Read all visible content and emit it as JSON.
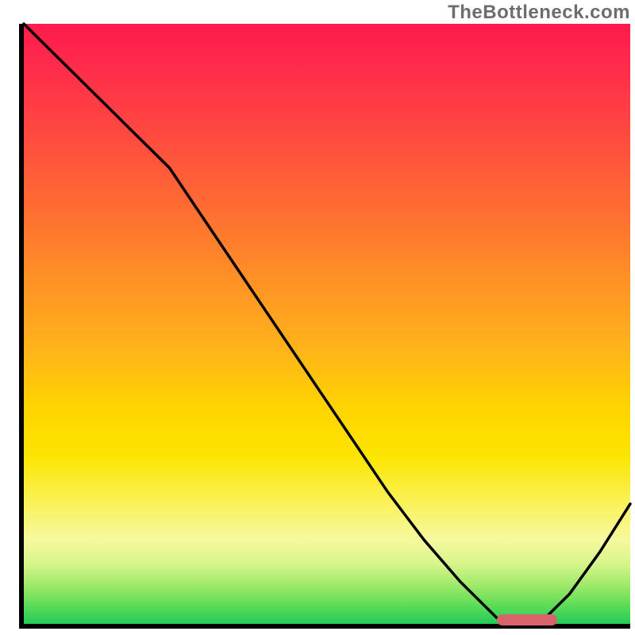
{
  "watermark": "TheBottleneck.com",
  "colors": {
    "axis": "#000000",
    "curve": "#000000",
    "marker": "#d9636b",
    "gradient_top": "#ff1a4d",
    "gradient_bottom": "#22cc55"
  },
  "chart_data": {
    "type": "line",
    "title": "",
    "xlabel": "",
    "ylabel": "",
    "xlim": [
      0,
      100
    ],
    "ylim": [
      0,
      100
    ],
    "x": [
      0,
      6,
      12,
      18,
      24,
      30,
      36,
      42,
      48,
      54,
      60,
      66,
      72,
      78,
      81,
      85,
      90,
      95,
      100
    ],
    "values": [
      100,
      94,
      88,
      82,
      76,
      67,
      58,
      49,
      40,
      31,
      22,
      14,
      7,
      1,
      0,
      0,
      5,
      12,
      20
    ],
    "marker": {
      "x_start": 78,
      "x_end": 88,
      "y": 0
    },
    "annotations": []
  }
}
